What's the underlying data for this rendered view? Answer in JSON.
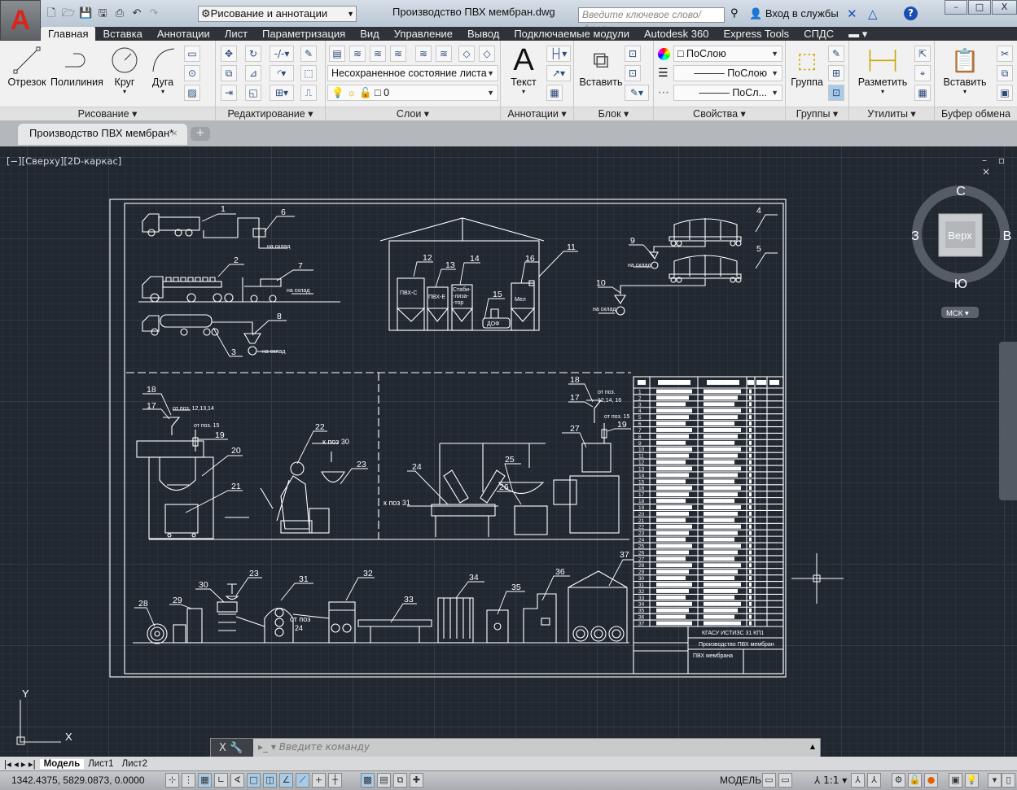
{
  "titlebar": {
    "app_logo": "A",
    "workspace": "Рисование и аннотации",
    "title": "Производство ПВХ мембран.dwg",
    "search_placeholder": "Введите ключевое слово/фразу",
    "signin": "Вход в службы",
    "help": "?",
    "min": "–",
    "max": "□",
    "close": "X"
  },
  "quick_access": [
    "new-icon",
    "open-icon",
    "save-icon",
    "save-as-icon",
    "print-icon",
    "undo-icon",
    "redo-icon"
  ],
  "tabs": [
    "Главная",
    "Вставка",
    "Аннотации",
    "Лист",
    "Параметризация",
    "Вид",
    "Управление",
    "Вывод",
    "Подключаемые модули",
    "Autodesk 360",
    "Express Tools",
    "СПДС"
  ],
  "active_tab": "Главная",
  "ribbon": {
    "draw": {
      "title": "Рисование ▾",
      "line": "Отрезок",
      "polyline": "Полилиния",
      "circle": "Круг",
      "arc": "Дуга"
    },
    "modify": {
      "title": "Редактирование ▾"
    },
    "layers": {
      "title": "Слои ▾",
      "layer_state": "Несохраненное состояние листа",
      "current_layer": "0"
    },
    "annotation": {
      "title": "Аннотации ▾",
      "text": "Текст"
    },
    "block": {
      "title": "Блок ▾",
      "insert": "Вставить"
    },
    "properties": {
      "title": "Свойства ▾",
      "color": "ПоСлою",
      "lineweight": "ПоСлою",
      "linetype": "ПоСл..."
    },
    "groups": {
      "title": "Группы ▾",
      "group": "Группа"
    },
    "utilities": {
      "title": "Утилиты ▾",
      "measure": "Разметить"
    },
    "clipboard": {
      "title": "Буфер обмена",
      "paste": "Вставить"
    }
  },
  "file_tab": {
    "label": "Производство ПВХ мембран*",
    "close": "×",
    "new": "+"
  },
  "viewport": {
    "label": "[−][Сверху][2D-каркас]",
    "controls": "– ▫ ×"
  },
  "viewcube": {
    "top": "Верх",
    "north": "С",
    "south": "Ю",
    "west": "З",
    "east": "В",
    "ucs": "МСК ▾"
  },
  "ucs_icon": {
    "x": "X",
    "y": "Y"
  },
  "drawing": {
    "callouts": [
      "1",
      "2",
      "3",
      "4",
      "5",
      "6",
      "7",
      "8",
      "9",
      "10",
      "11",
      "12",
      "13",
      "14",
      "15",
      "16",
      "17",
      "18",
      "19",
      "20",
      "21",
      "22",
      "23",
      "24",
      "25",
      "26",
      "27",
      "28",
      "29",
      "30",
      "31",
      "32",
      "33",
      "34",
      "35",
      "36",
      "37"
    ],
    "to_storage": "на склад",
    "silo_labels": {
      "pvc_s": "ПВХ-С",
      "pvc_e": "ПВХ-Е",
      "stab1": "Стаби-",
      "stab2": "-лиза-",
      "stab3": "-тор",
      "dof": "ДОФ",
      "chalk": "Мел"
    },
    "notes": {
      "from_12_13_14": "от поз. 12,13,14",
      "from_15": "от поз. 15",
      "to_30": "к поз 30",
      "to_31": "к поз 31",
      "from_a": "от поз.",
      "from_12_14_16": "12,14, 16",
      "from_15b": "от поз. 15",
      "from_24a": "от поз",
      "from_24b": "24"
    },
    "title_block": {
      "org": "КГАСУ ИСТИЗС 31 КП1",
      "name": "Производство ПВХ мембран",
      "product": "ПВХ мембрана"
    },
    "spec_rows": [
      "1",
      "2",
      "3",
      "4",
      "5",
      "6",
      "7",
      "8",
      "9",
      "10",
      "11",
      "12",
      "13",
      "14",
      "15",
      "16",
      "17",
      "18",
      "19",
      "20",
      "21",
      "22",
      "23",
      "24",
      "25",
      "26",
      "27",
      "28",
      "29",
      "30",
      "31",
      "32",
      "33",
      "34",
      "35",
      "36",
      "37"
    ]
  },
  "command_line": {
    "close": "X",
    "placeholder": "Введите команду"
  },
  "layout_tabs": [
    "Модель",
    "Лист1",
    "Лист2"
  ],
  "active_layout": "Модель",
  "status": {
    "coords": "1342.4375, 5829.0873, 0.0000",
    "space": "МОДЕЛЬ",
    "scale": "1:1 ▾"
  },
  "colors": {
    "canvas": "#212830",
    "accent": "#d8261c",
    "line": "#ffffff"
  }
}
